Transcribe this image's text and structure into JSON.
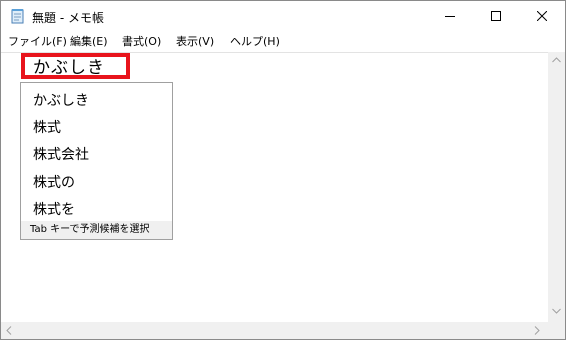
{
  "window": {
    "title": "無題 - メモ帳"
  },
  "menu": {
    "file": "ファイル(F)",
    "edit": "編集(E)",
    "format": "書式(O)",
    "view": "表示(V)",
    "help": "ヘルプ(H)"
  },
  "editor": {
    "composition_text": "かぶしき"
  },
  "ime": {
    "candidates": [
      "かぶしき",
      "株式",
      "株式会社",
      "株式の",
      "株式を"
    ],
    "footer": "Tab キーで予測候補を選択"
  },
  "colors": {
    "highlight": "#e8141c",
    "footer_bg": "#f0f0f0"
  },
  "icons": {
    "app": "notepad-icon",
    "minimize": "minimize-icon",
    "maximize": "maximize-icon",
    "close": "close-icon"
  }
}
